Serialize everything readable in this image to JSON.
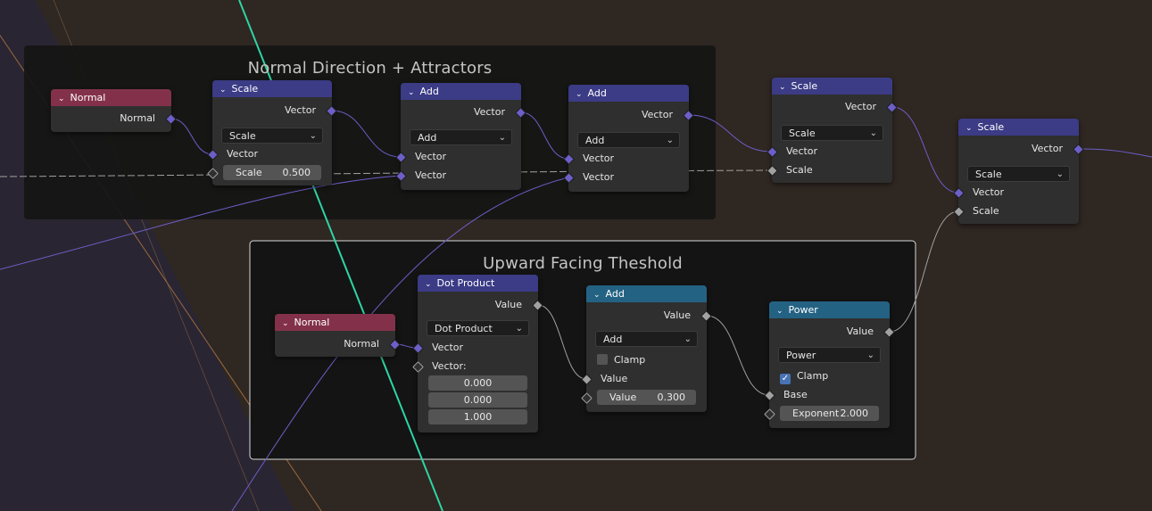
{
  "frames": {
    "top": {
      "title": "Normal Direction + Attractors"
    },
    "bottom": {
      "title": "Upward Facing Theshold"
    }
  },
  "icons": {
    "collapse": "chevron-down-icon",
    "dropdown": "chevron-down-icon",
    "check": "checkmark-icon"
  },
  "colors": {
    "vector_header": "#3b3b86",
    "input_header": "#83314a",
    "math_header": "#246283",
    "vector_socket": "#6c5fc7",
    "value_socket": "#a1a1a1",
    "frame_selected_border": "#d9d9d9"
  },
  "nodes": {
    "normal1": {
      "title": "Normal",
      "out": "Normal"
    },
    "scale1": {
      "title": "Scale",
      "out": "Vector",
      "op": "Scale",
      "in1": "Vector",
      "field_label": "Scale",
      "field_value": "0.500"
    },
    "add1": {
      "title": "Add",
      "out": "Vector",
      "op": "Add",
      "in1": "Vector",
      "in2": "Vector"
    },
    "add2": {
      "title": "Add",
      "out": "Vector",
      "op": "Add",
      "in1": "Vector",
      "in2": "Vector"
    },
    "scale2": {
      "title": "Scale",
      "out": "Vector",
      "op": "Scale",
      "in1": "Vector",
      "in2": "Scale"
    },
    "scale3": {
      "title": "Scale",
      "out": "Vector",
      "op": "Scale",
      "in1": "Vector",
      "in2": "Scale"
    },
    "normal2": {
      "title": "Normal",
      "out": "Normal"
    },
    "dot": {
      "title": "Dot Product",
      "out": "Value",
      "op": "Dot Product",
      "in1": "Vector",
      "in2": "Vector:",
      "x": "0.000",
      "y": "0.000",
      "z": "1.000"
    },
    "add3": {
      "title": "Add",
      "out": "Value",
      "op": "Add",
      "clamp_label": "Clamp",
      "clamp": false,
      "in1": "Value",
      "field_label": "Value",
      "field_value": "0.300"
    },
    "power": {
      "title": "Power",
      "out": "Value",
      "op": "Power",
      "clamp_label": "Clamp",
      "clamp": true,
      "in1": "Base",
      "field_label": "Exponent",
      "field_value": "2.000"
    }
  }
}
